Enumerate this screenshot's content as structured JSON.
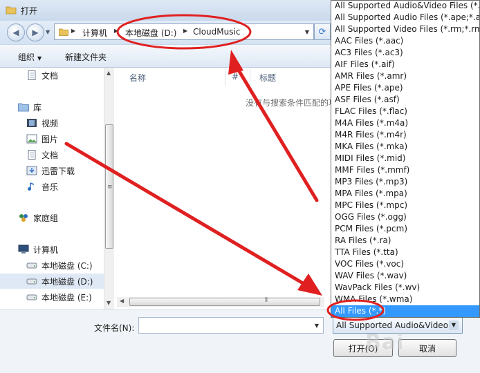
{
  "window": {
    "title": "打开"
  },
  "address": {
    "crumbs": [
      "计算机",
      "本地磁盘 (D:)",
      "CloudMusic"
    ]
  },
  "toolbar": {
    "organize": "组织",
    "new_folder": "新建文件夹"
  },
  "sidebar": {
    "items": [
      {
        "label": "文档",
        "icon": "document-icon"
      },
      {
        "label": "库",
        "icon": "library-icon"
      },
      {
        "label": "视频",
        "icon": "video-icon"
      },
      {
        "label": "图片",
        "icon": "picture-icon"
      },
      {
        "label": "文档",
        "icon": "document-icon"
      },
      {
        "label": "迅雷下载",
        "icon": "download-icon"
      },
      {
        "label": "音乐",
        "icon": "music-icon"
      },
      {
        "label": "家庭组",
        "icon": "homegroup-icon"
      },
      {
        "label": "计算机",
        "icon": "computer-icon"
      },
      {
        "label": "本地磁盘 (C:)",
        "icon": "drive-icon"
      },
      {
        "label": "本地磁盘 (D:)",
        "icon": "drive-icon"
      },
      {
        "label": "本地磁盘 (E:)",
        "icon": "drive-icon"
      }
    ]
  },
  "content": {
    "columns": [
      "名称",
      "#",
      "标题"
    ],
    "empty_message": "没有与搜索条件匹配的项"
  },
  "bottom": {
    "filename_label": "文件名(N):",
    "filename_value": "",
    "filetype_selected": "All Supported Audio&Video",
    "open_label": "打开(O)",
    "cancel_label": "取消"
  },
  "filetype_options": [
    "All Supported Audio&Video Files (*.a",
    "All Supported Audio Files (*.ape;*.am",
    "All Supported Video Files (*.rm;*.rmv",
    "AAC Files (*.aac)",
    "AC3 Files (*.ac3)",
    "AIF Files (*.aif)",
    "AMR Files (*.amr)",
    "APE Files (*.ape)",
    "ASF Files (*.asf)",
    "FLAC Files (*.flac)",
    "M4A Files (*.m4a)",
    "M4R Files (*.m4r)",
    "MKA Files (*.mka)",
    "MIDI Files (*.mid)",
    "MMF Files (*.mmf)",
    "MP3 Files (*.mp3)",
    "MPA Files (*.mpa)",
    "MPC Files (*.mpc)",
    "OGG Files (*.ogg)",
    "PCM Files (*.pcm)",
    "RA Files (*.ra)",
    "TTA Files (*.tta)",
    "VOC Files (*.voc)",
    "WAV Files (*.wav)",
    "WavPack Files (*.wv)",
    "WMA Files (*.wma)",
    "All Files (*.*)"
  ],
  "selected_filetype_index": 26,
  "annotation": {
    "color": "#e02020",
    "watermark": "Bai"
  }
}
